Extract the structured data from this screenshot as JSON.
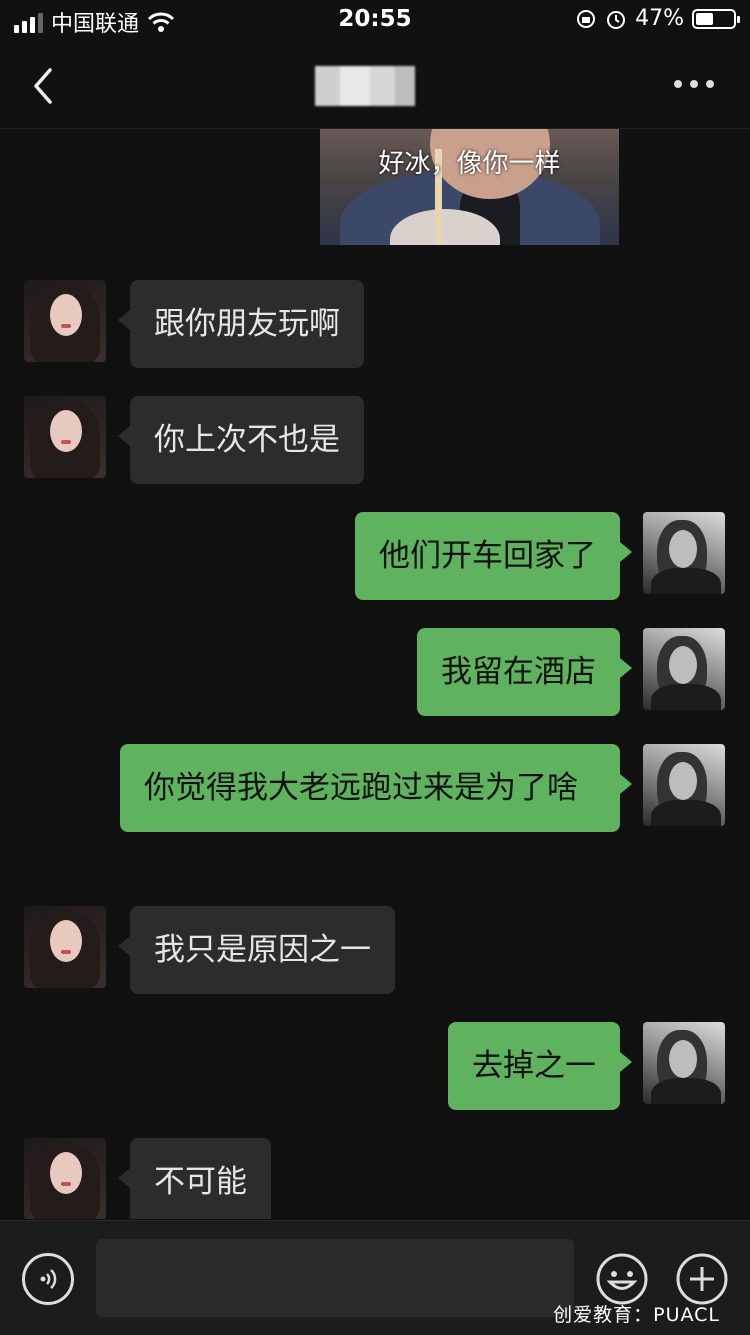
{
  "status_bar": {
    "carrier": "中国联通",
    "time": "20:55",
    "battery_percent_text": "47%",
    "battery_level": 0.47
  },
  "nav": {
    "back_icon": "chevron-left-icon",
    "more_icon": "more-dots-icon"
  },
  "image_message": {
    "caption": "好冰，像你一样"
  },
  "messages": [
    {
      "side": "left",
      "text": "跟你朋友玩啊"
    },
    {
      "side": "left",
      "text": "你上次不也是"
    },
    {
      "side": "right",
      "text": "他们开车回家了"
    },
    {
      "side": "right",
      "text": "我留在酒店"
    },
    {
      "side": "right",
      "text": "你觉得我大老远跑过来是为了啥"
    },
    {
      "side": "left",
      "text": "我只是原因之一"
    },
    {
      "side": "right",
      "text": "去掉之一"
    },
    {
      "side": "left",
      "text": "不可能"
    }
  ],
  "input_bar": {
    "voice_icon": "voice-icon",
    "emoji_icon": "emoji-icon",
    "plus_icon": "plus-icon"
  },
  "watermark": "创爱教育：PUACL",
  "colors": {
    "background": "#111111",
    "incoming_bubble": "#2c2c2c",
    "outgoing_bubble": "#5fb35f"
  }
}
